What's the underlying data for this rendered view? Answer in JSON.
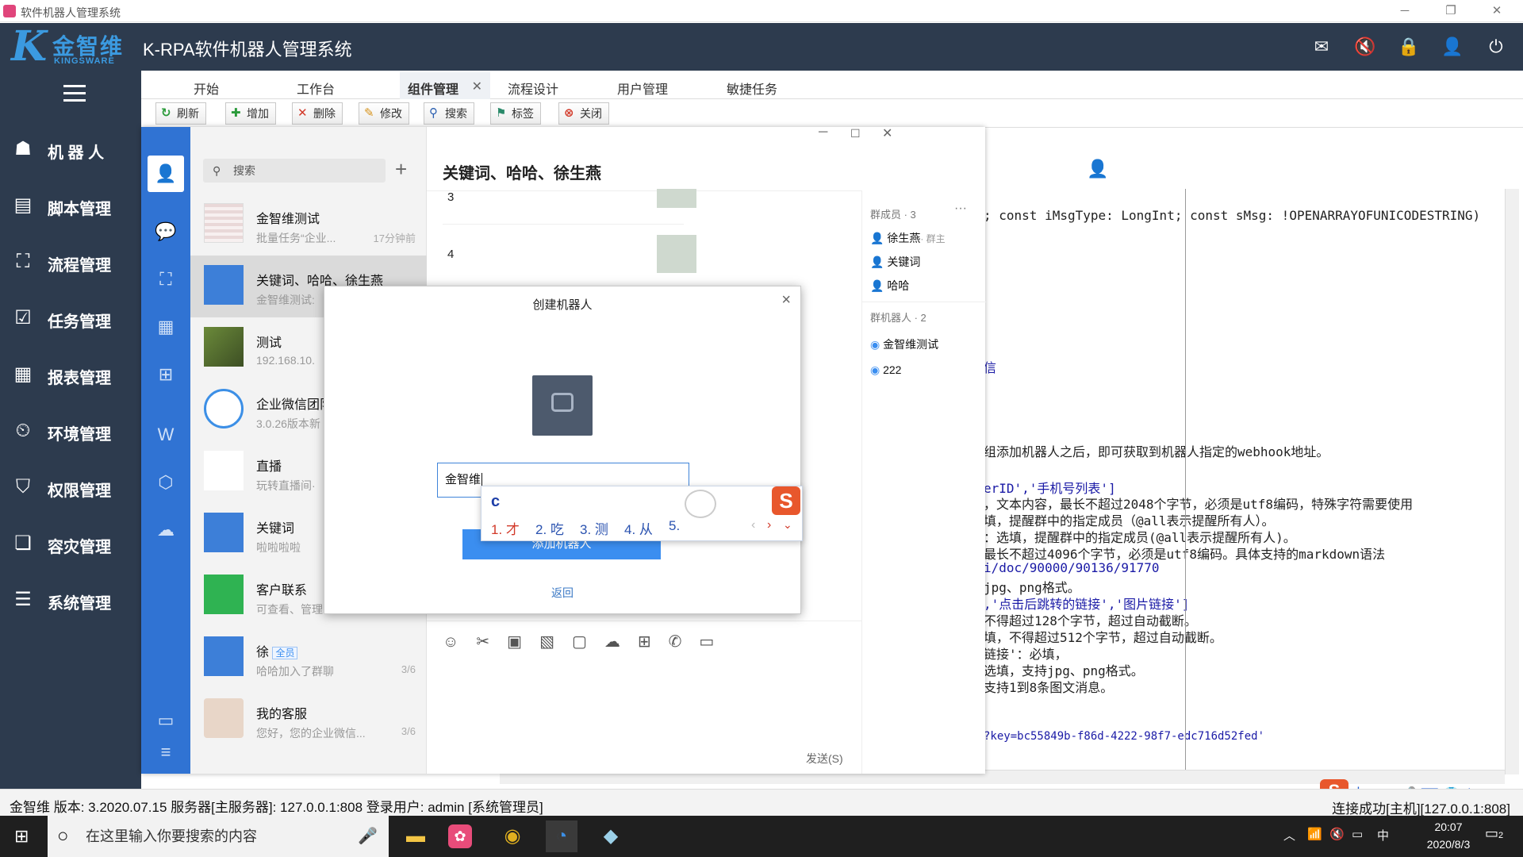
{
  "window": {
    "title": "软件机器人管理系统"
  },
  "header": {
    "logo_k": "K",
    "logo_cn": "金智维",
    "logo_en": "KINGSWARE",
    "app_title": "K-RPA软件机器人管理系统"
  },
  "sidebar": {
    "items": [
      {
        "label": "机 器 人",
        "icon": "robot-icon"
      },
      {
        "label": "脚本管理",
        "icon": "script-icon"
      },
      {
        "label": "流程管理",
        "icon": "process-icon"
      },
      {
        "label": "任务管理",
        "icon": "task-icon"
      },
      {
        "label": "报表管理",
        "icon": "report-icon"
      },
      {
        "label": "环境管理",
        "icon": "environment-icon"
      },
      {
        "label": "权限管理",
        "icon": "permission-icon"
      },
      {
        "label": "容灾管理",
        "icon": "disaster-recovery-icon"
      },
      {
        "label": "系统管理",
        "icon": "system-icon"
      }
    ]
  },
  "tabs": [
    {
      "label": "开始"
    },
    {
      "label": "工作台"
    },
    {
      "label": "组件管理",
      "active": true
    },
    {
      "label": "流程设计"
    },
    {
      "label": "用户管理"
    },
    {
      "label": "敏捷任务"
    }
  ],
  "toolbar": {
    "refresh": "刷新",
    "add": "增加",
    "delete": "删除",
    "edit": "修改",
    "search": "搜索",
    "tag": "标签",
    "close": "关闭"
  },
  "editor": {
    "lines": [
      "; const iMsgType: LongInt; const sMsg: !OPENARRAYOFUNICODESTRING)",
      "信",
      "组添加机器人之后，即可获取到机器人指定的webhook地址。",
      "erID','手机号列表']",
      "，文本内容，最长不超过2048个字节，必须是utf8编码，特殊字符需要使用",
      "填，提醒群中的指定成员（@all表示提醒所有人）。",
      "：选填，提醒群中的指定成员(@all表示提醒所有人)。",
      "最长不超过4096个字节，必须是utf8编码。具体支持的markdown语法",
      "i/doc/90000/90136/91770",
      "jpg、png格式。",
      ",'点击后跳转的链接','图片链接']",
      "不得超过128个字节，超过自动截断。",
      "填，不得超过512个字节，超过自动截断。",
      "链接'：必填，",
      "选填，支持jpg、png格式。",
      "支持1到8条图文消息。",
      "?key=bc55849b-f86d-4222-98f7-edc716d52fed'"
    ]
  },
  "wecom": {
    "search_placeholder": "搜索",
    "conversations": [
      {
        "name": "金智维测试",
        "msg": "批量任务“企业...",
        "time": "17分钟前"
      },
      {
        "name": "关键词、哈哈、徐生燕",
        "msg": "金智维测试:",
        "time": ""
      },
      {
        "name": "测试",
        "msg": "192.168.10.",
        "time": ""
      },
      {
        "name": "企业微信团队",
        "msg": "3.0.26版本新",
        "time": ""
      },
      {
        "name": "直播",
        "msg": "玩转直播间·",
        "time": ""
      },
      {
        "name": "关键词",
        "msg": "啦啦啦啦",
        "time": ""
      },
      {
        "name": "客户联系",
        "msg": "可查看、管理",
        "time": ""
      },
      {
        "name": "徐",
        "badge": "全员",
        "msg": "哈哈加入了群聊",
        "time": "3/6"
      },
      {
        "name": "我的客服",
        "msg": "您好，您的企业微信...",
        "time": "3/6"
      }
    ],
    "chat": {
      "title": "关键词、哈哈、徐生燕",
      "messages": [
        "3",
        "4"
      ],
      "send": "发送(S)"
    },
    "side": {
      "members_label": "群成员 · 3",
      "members": [
        {
          "name": "徐生燕",
          "role": "· 群主"
        },
        {
          "name": "关键词",
          "role": ""
        },
        {
          "name": "哈哈",
          "role": ""
        }
      ],
      "robots_label": "群机器人 · 2",
      "robots": [
        {
          "name": "金智维测试"
        },
        {
          "name": "222"
        }
      ]
    }
  },
  "dialog": {
    "title": "创建机器人",
    "input_value": "金智维",
    "add_button": "添加机器人",
    "back": "返回"
  },
  "ime": {
    "composition": "c",
    "candidates": [
      "1. 才",
      "2. 吃",
      "3. 测",
      "4. 从",
      "5."
    ],
    "toolbar": "中 °, ☺ 🎤 ⌨ 👕 ⬆ ▦"
  },
  "status": {
    "left": "金智维  版本: 3.2020.07.15  服务器[主服务器]: 127.0.0.1:808  登录用户: admin [系统管理员]",
    "right": "连接成功[主机][127.0.0.1:808]"
  },
  "taskbar": {
    "search_placeholder": "在这里输入你要搜索的内容",
    "tray": {
      "input_method": "中",
      "time": "20:07",
      "date": "2020/8/3",
      "notifications": "2"
    }
  },
  "colors": {
    "header_bg": "#2d3b4e",
    "brand_blue": "#3b9ae0",
    "wecom_blue": "#3073d3",
    "button_blue": "#3b8ef0"
  }
}
